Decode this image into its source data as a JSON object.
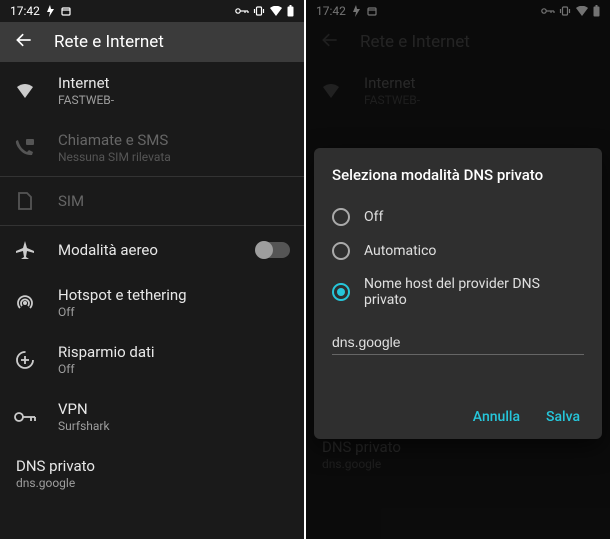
{
  "status": {
    "time": "17:42",
    "leftIcons": [
      "bolt",
      "calendar"
    ],
    "rightIcons": [
      "key",
      "vibrate",
      "wifi",
      "battery"
    ]
  },
  "title": "Rete e Internet",
  "internet": {
    "title": "Internet",
    "sub": "FASTWEB-"
  },
  "calls": {
    "title": "Chiamate e SMS",
    "sub": "Nessuna SIM rilevata"
  },
  "sim": {
    "title": "SIM"
  },
  "airplane": {
    "title": "Modalità aereo"
  },
  "hotspot": {
    "title": "Hotspot e tethering",
    "sub": "Off"
  },
  "datasaver": {
    "title": "Risparmio dati",
    "sub": "Off"
  },
  "vpn": {
    "title": "VPN",
    "sub": "Surfshark"
  },
  "dns": {
    "title": "DNS privato",
    "sub": "dns.google"
  },
  "dialog": {
    "title": "Seleziona modalità DNS privato",
    "off": "Off",
    "auto": "Automatico",
    "custom": "Nome host del provider DNS privato",
    "value": "dns.google",
    "cancel": "Annulla",
    "save": "Salva"
  }
}
